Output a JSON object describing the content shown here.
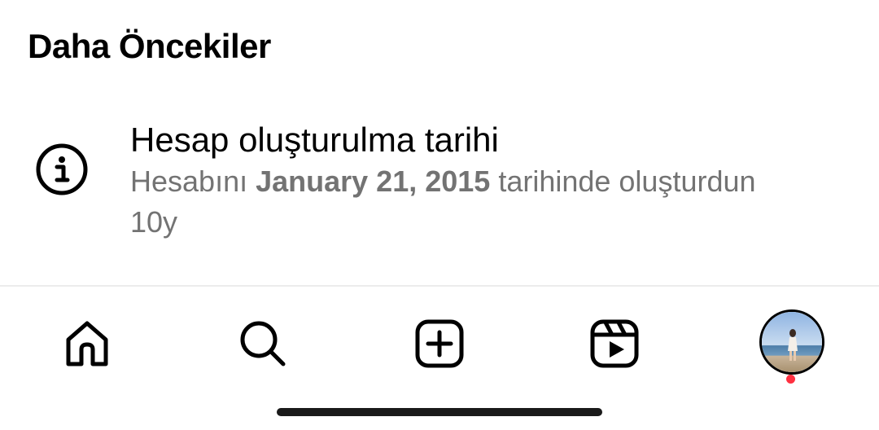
{
  "section": {
    "title": "Daha Öncekiler"
  },
  "activity": {
    "icon": "info-icon",
    "title": "Hesap oluşturulma tarihi",
    "desc_prefix": "Hesabını ",
    "desc_date": "January 21, 2015",
    "desc_suffix": " tarihinde oluşturdun",
    "time": "10y"
  },
  "nav": {
    "items": [
      {
        "name": "home",
        "icon": "home-icon"
      },
      {
        "name": "search",
        "icon": "search-icon"
      },
      {
        "name": "create",
        "icon": "plus-square-icon"
      },
      {
        "name": "reels",
        "icon": "reels-icon"
      },
      {
        "name": "profile",
        "icon": "avatar"
      }
    ],
    "notification_color": "#ff3040"
  },
  "colors": {
    "primary_text": "#000000",
    "secondary_text": "#737373",
    "background": "#ffffff"
  }
}
